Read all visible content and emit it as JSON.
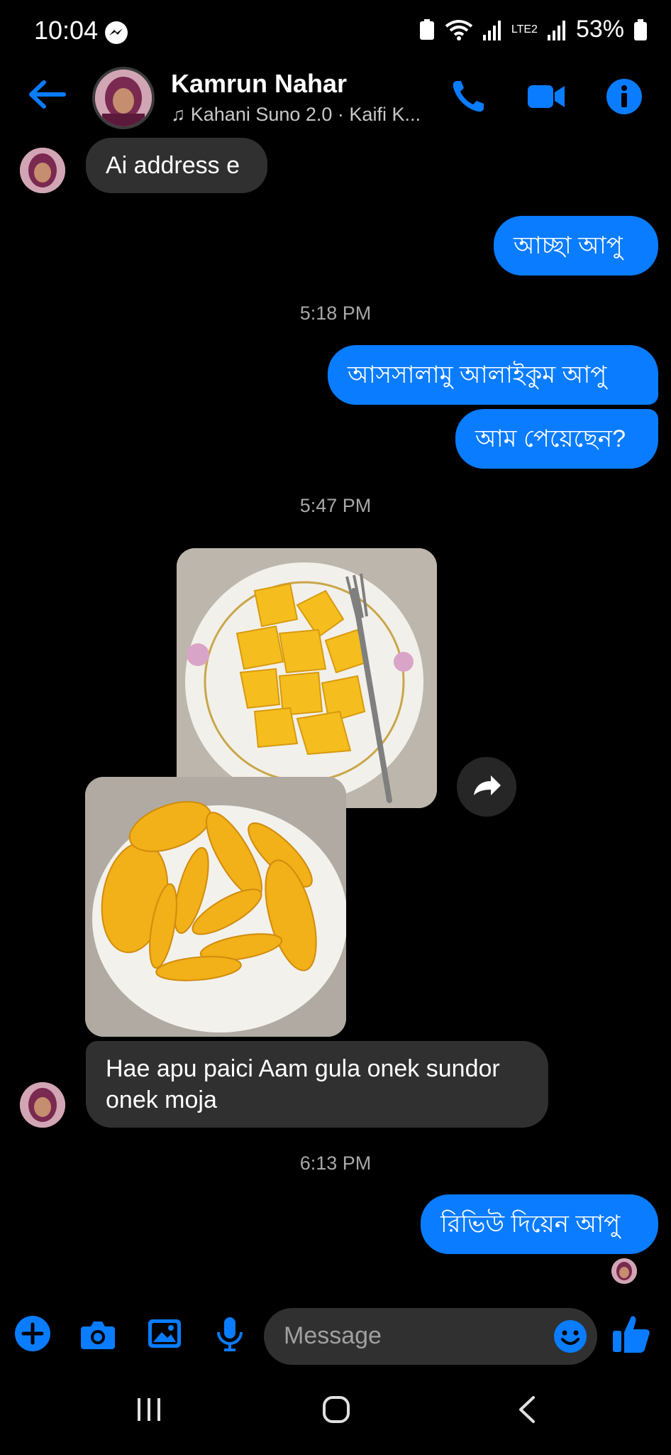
{
  "status_bar": {
    "time": "10:04",
    "battery": "53%",
    "network": "LTE2"
  },
  "header": {
    "contact_name": "Kamrun Nahar",
    "now_playing": "Kahani Suno 2.0 · Kaifi K..."
  },
  "messages": [
    {
      "side": "in",
      "text": "Ai address e"
    },
    {
      "side": "out",
      "text": "আচ্ছা আপু"
    },
    {
      "type": "timestamp",
      "text": "5:18 PM"
    },
    {
      "side": "out",
      "text": "আসসালামু আলাইকুম আপু"
    },
    {
      "side": "out",
      "text": "আম পেয়েছেন?"
    },
    {
      "type": "timestamp",
      "text": "5:47 PM"
    },
    {
      "side": "in",
      "type": "photos",
      "count": 2
    },
    {
      "side": "in",
      "text_line1": "Hae apu paici Aam gula onek sundor",
      "text_line2": "onek moja"
    },
    {
      "type": "timestamp",
      "text": "6:13 PM"
    },
    {
      "side": "out",
      "text": "রিভিউ দিয়েন আপু"
    }
  ],
  "composer": {
    "placeholder": "Message"
  },
  "colors": {
    "accent": "#0a7cff",
    "incoming_bubble": "#303030",
    "background": "#000000"
  }
}
